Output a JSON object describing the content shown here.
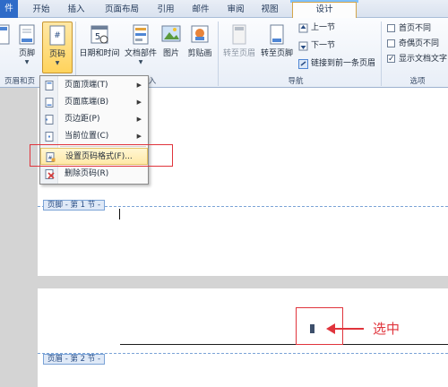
{
  "tabs": {
    "file": "件",
    "home": "开始",
    "insert": "插入",
    "layout": "页面布局",
    "references": "引用",
    "mailings": "邮件",
    "review": "审阅",
    "view": "视图",
    "design": "设计"
  },
  "ribbon": {
    "header_footer_group": {
      "label": "页眉和页",
      "footer_button": "页脚",
      "page_number_button": "页码"
    },
    "insert_group": {
      "label": "入",
      "date_time_button": "日期和时间",
      "doc_parts_button": "文档部件",
      "picture_button": "图片",
      "clipart_button": "剪贴画"
    },
    "navigation_group": {
      "label": "导航",
      "goto_header_button": "转至页眉",
      "goto_footer_button": "转至页脚",
      "prev_section": "上一节",
      "next_section": "下一节",
      "link_previous": "链接到前一条页眉"
    },
    "options_group": {
      "label": "选项",
      "different_first_page": "首页不同",
      "different_odd_even": "奇偶页不同",
      "show_document_text": "显示文档文字",
      "different_first_page_checked": false,
      "different_odd_even_checked": false,
      "show_document_text_checked": true
    }
  },
  "menu": {
    "top_of_page": "页面顶端(T)",
    "bottom_of_page": "页面底端(B)",
    "page_margins": "页边距(P)",
    "current_position": "当前位置(C)",
    "format_page_numbers": "设置页码格式(F)...",
    "remove_page_numbers": "删除页码(R)"
  },
  "document": {
    "footer_tag": "页脚 - 第 1 节 -",
    "header_tag": "页眉 - 第 2 节 -",
    "callout": "选中"
  },
  "colors": {
    "accent_blue": "#2e6bc8",
    "highlight_red": "#e0343c",
    "active_button": "#ffd35c"
  }
}
